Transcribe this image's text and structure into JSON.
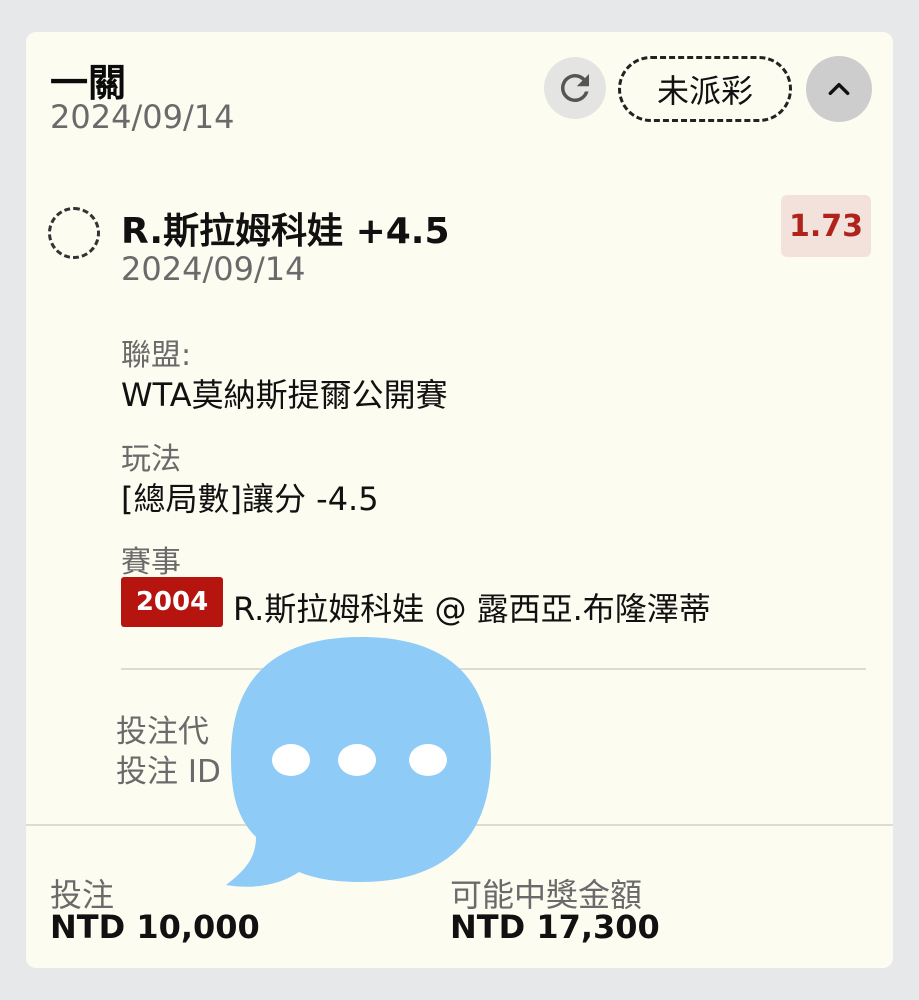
{
  "bet": {
    "title": "一關",
    "date": "2024/09/14",
    "status_label": "未派彩"
  },
  "selection": {
    "name": "R.斯拉姆科娃 +4.5",
    "date": "2024/09/14",
    "odds": "1.73",
    "league_label": "聯盟:",
    "league_value": "WTA莫納斯提爾公開賽",
    "market_label": "玩法",
    "market_value": "[總局數]讓分 -4.5",
    "event_label": "賽事",
    "event_id": "2004",
    "event_value": "R.斯拉姆科娃 @ 露西亞.布隆澤蒂"
  },
  "ids": {
    "code_label": "投注代",
    "id_label": "投注 ID"
  },
  "footer": {
    "stake_label": "投注",
    "stake_value": "NTD 10,000",
    "payout_label": "可能中獎金額",
    "payout_value": "NTD 17,300"
  },
  "icons": {
    "refresh": "refresh-icon",
    "collapse": "chevron-up-icon",
    "sticker": "speech-bubble-icon"
  },
  "colors": {
    "card_bg": "#fdfcf1",
    "odds_text": "#b0231c",
    "odds_bg": "#f3e1dc",
    "event_badge": "#b5140f",
    "sticker": "#8ecbf7"
  }
}
